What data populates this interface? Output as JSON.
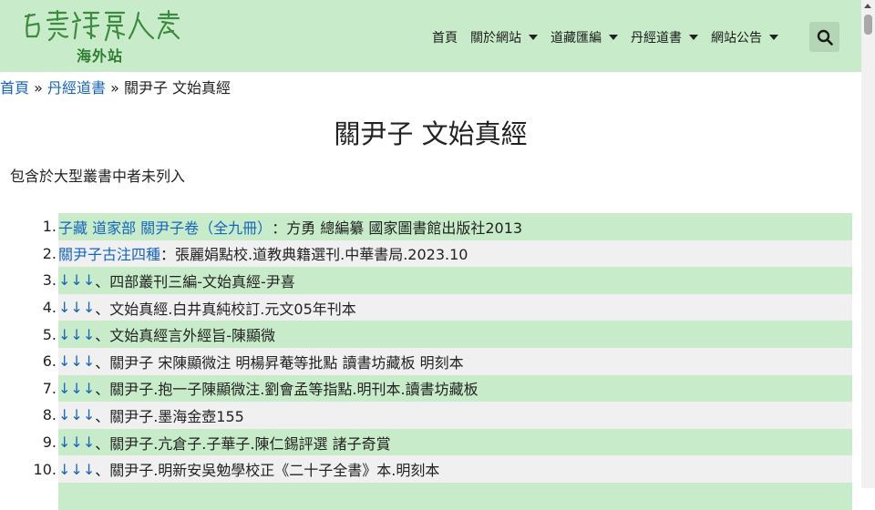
{
  "header": {
    "logo_subtitle": "海外站",
    "nav": [
      {
        "label": "首頁",
        "dropdown": false
      },
      {
        "label": "關於網站",
        "dropdown": true
      },
      {
        "label": "道藏匯編",
        "dropdown": true
      },
      {
        "label": "丹經道書",
        "dropdown": true
      },
      {
        "label": "網站公告",
        "dropdown": true
      }
    ],
    "search_icon": "search-icon"
  },
  "breadcrumb": {
    "home": "首頁",
    "sep1": " » ",
    "category": "丹經道書",
    "sep2": " » ",
    "current": "關尹子 文始真經"
  },
  "page": {
    "title": "關尹子 文始真經",
    "intro": "包含於大型叢書中者未列入"
  },
  "items": [
    {
      "num": "1.",
      "link": "子藏 道家部 關尹子卷（全九冊）",
      "text": "：方勇 總編纂 國家圖書館出版社2013"
    },
    {
      "num": "2.",
      "link": "關尹子古注四種",
      "text": "：張麗娟點校.道教典籍選刊.中華書局.2023.10"
    },
    {
      "num": "3.",
      "link": "↓↓↓",
      "text": "、四部叢刊三編-文始真經-尹喜"
    },
    {
      "num": "4.",
      "link": "↓↓↓",
      "text": "、文始真經.白井真純校訂.元文05年刊本"
    },
    {
      "num": "5.",
      "link": "↓↓↓",
      "text": "、文始真經言外經旨-陳顯微"
    },
    {
      "num": "6.",
      "link": "↓↓↓",
      "text": "、關尹子 宋陳顯微注 明楊昇菴等批點 讀書坊藏板 明刻本"
    },
    {
      "num": "7.",
      "link": "↓↓↓",
      "text": "、關尹子.抱一子陳顯微注.劉會孟等指點.明刊本.讀書坊藏板"
    },
    {
      "num": "8.",
      "link": "↓↓↓",
      "text": "、關尹子.墨海金壺155"
    },
    {
      "num": "9.",
      "link": "↓↓↓",
      "text": "、關尹子.亢倉子.子華子.陳仁錫評選 諸子奇賞"
    },
    {
      "num": "10.",
      "link": "↓↓↓",
      "text": "、關尹子.明新安吳勉學校正《二十子全書》本.明刻本"
    },
    {
      "num": "",
      "link": "",
      "text": ""
    }
  ],
  "colors": {
    "header_bg": "#c8ecc9",
    "link": "#1565c0",
    "row_green": "#c8ecc9",
    "row_gray": "#f0f0f0"
  }
}
